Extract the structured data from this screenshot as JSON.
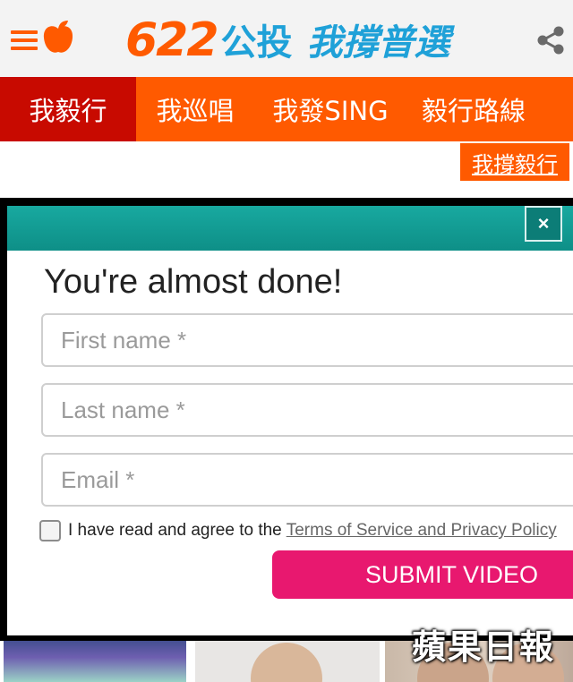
{
  "header": {
    "logo_number": "622",
    "logo_vote": "公投",
    "logo_slogan": "我撐普選",
    "icons": {
      "menu": "menu-icon",
      "brand": "apple-icon",
      "share": "share-icon"
    }
  },
  "nav": {
    "items": [
      {
        "label": "我毅行",
        "active": true
      },
      {
        "label": "我巡唱",
        "active": false
      },
      {
        "label": "我發SING",
        "active": false
      },
      {
        "label": "毅行路線",
        "active": false
      }
    ]
  },
  "support_button": "我撐毅行",
  "modal": {
    "close_label": "×",
    "title": "You're almost done!",
    "fields": {
      "first_name_placeholder": "First name *",
      "last_name_placeholder": "Last name *",
      "email_placeholder": "Email *"
    },
    "agree_text": "I have read and agree to the",
    "agree_link": "Terms of Service and Privacy Policy",
    "submit_label": "SUBMIT VIDEO"
  },
  "watermark": "蘋果日報",
  "colors": {
    "brand_orange": "#ff5a00",
    "nav_active": "#c80a00",
    "brand_blue": "#1fa1d8",
    "modal_teal": "#12a098",
    "submit_pink": "#e8186f"
  }
}
